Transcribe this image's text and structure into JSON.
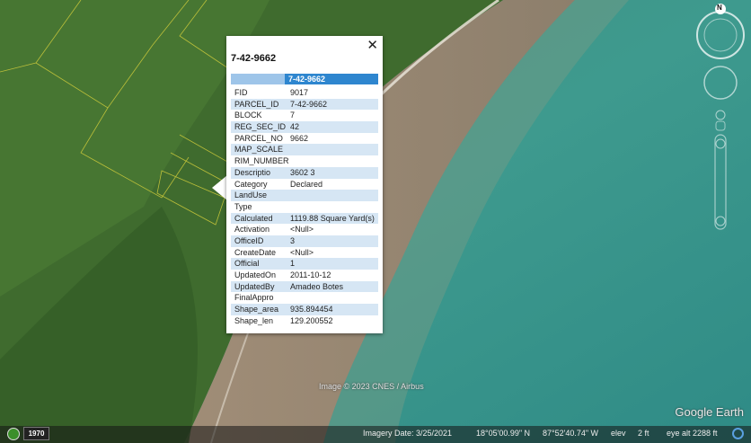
{
  "popup": {
    "close_glyph": "✕",
    "title": "7-42-9662",
    "header_value": "7-42-9662",
    "rows": [
      {
        "key": "FID",
        "value": "9017"
      },
      {
        "key": "PARCEL_ID",
        "value": "7-42-9662"
      },
      {
        "key": "BLOCK",
        "value": "7"
      },
      {
        "key": "REG_SEC_ID",
        "value": "42"
      },
      {
        "key": "PARCEL_NO",
        "value": "9662"
      },
      {
        "key": "MAP_SCALE",
        "value": ""
      },
      {
        "key": "RIM_NUMBER",
        "value": ""
      },
      {
        "key": "Descriptio",
        "value": "3602 3"
      },
      {
        "key": "Category",
        "value": "Declared"
      },
      {
        "key": "LandUse",
        "value": ""
      },
      {
        "key": "Type",
        "value": ""
      },
      {
        "key": "Calculated",
        "value": "1119.88 Square Yard(s)"
      },
      {
        "key": "Activation",
        "value": "<Null>"
      },
      {
        "key": "OfficeID",
        "value": "3"
      },
      {
        "key": "CreateDate",
        "value": "<Null>"
      },
      {
        "key": "Official",
        "value": "1"
      },
      {
        "key": "UpdatedOn",
        "value": "2011-10-12"
      },
      {
        "key": "UpdatedBy",
        "value": "Amadeo Botes"
      },
      {
        "key": "FinalAppro",
        "value": ""
      },
      {
        "key": "Shape_area",
        "value": "935.894454"
      },
      {
        "key": "Shape_len",
        "value": "129.200552"
      }
    ]
  },
  "map": {
    "credit": "Image © 2023 CNES / Airbus",
    "brand": "Google Earth",
    "compass_letter": "N"
  },
  "status": {
    "year": "1970",
    "imagery_date": "Imagery Date: 3/25/2021",
    "lat": "18°05'00.99\" N",
    "lon": "87°52'40.74\" W",
    "elev_label": "elev",
    "elev_value": "2 ft",
    "eye_alt": "eye alt  2288 ft"
  },
  "colors": {
    "forest": "#3f6b2e",
    "sand": "#9b8672",
    "water": "#3e958a",
    "popup_header": "#2e86cf",
    "row_alt": "#d6e6f4"
  }
}
